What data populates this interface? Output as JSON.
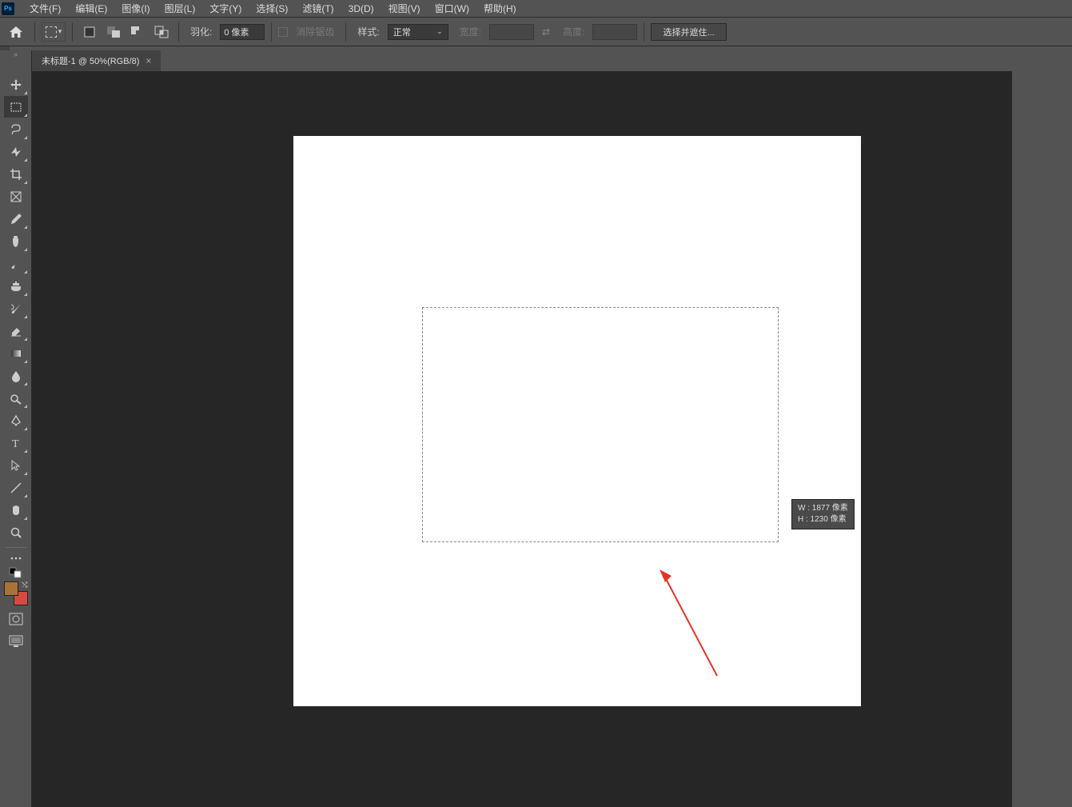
{
  "menu": {
    "items": [
      "文件(F)",
      "编辑(E)",
      "图像(I)",
      "图层(L)",
      "文字(Y)",
      "选择(S)",
      "滤镜(T)",
      "3D(D)",
      "视图(V)",
      "窗口(W)",
      "帮助(H)"
    ]
  },
  "options": {
    "feather_label": "羽化:",
    "feather_value": "0 像素",
    "antialias_label": "消除锯齿",
    "style_label": "样式:",
    "style_value": "正常",
    "width_label": "宽度:",
    "height_label": "高度:",
    "select_and_mask": "选择并遮住..."
  },
  "tab": {
    "title": "未标题-1 @ 50%(RGB/8)"
  },
  "selection_tooltip": {
    "line1": "W : 1877 像素",
    "line2": "H : 1230 像素"
  },
  "colors": {
    "foreground": "#a87436",
    "background": "#d84a3f"
  }
}
